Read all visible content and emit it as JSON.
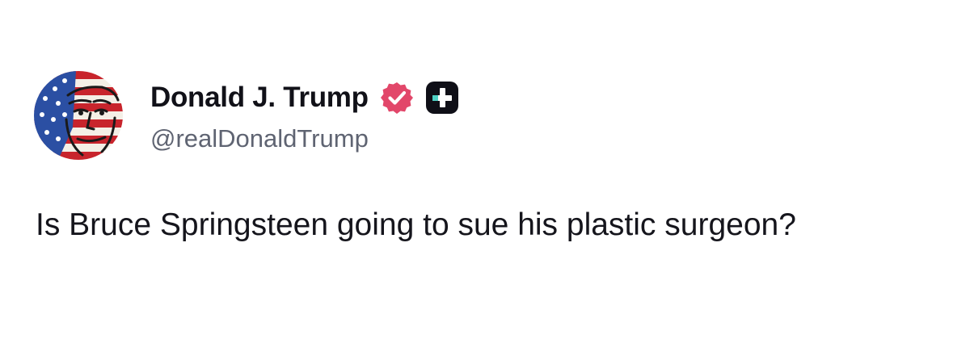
{
  "author": {
    "display_name": "Donald J. Trump",
    "handle": "@realDonaldTrump",
    "avatar_icon": "avatar-flag-portrait",
    "verified_icon": "verified-check-icon",
    "plus_icon": "plus-badge-icon"
  },
  "post": {
    "text": "Is Bruce Springsteen going to sue his plastic surgeon?"
  },
  "colors": {
    "verified_badge": "#e2476a",
    "plus_badge_bg": "#0f0f17",
    "plus_badge_accent": "#4fd1c5",
    "handle_text": "#5f6472",
    "body_text": "#15151c"
  }
}
